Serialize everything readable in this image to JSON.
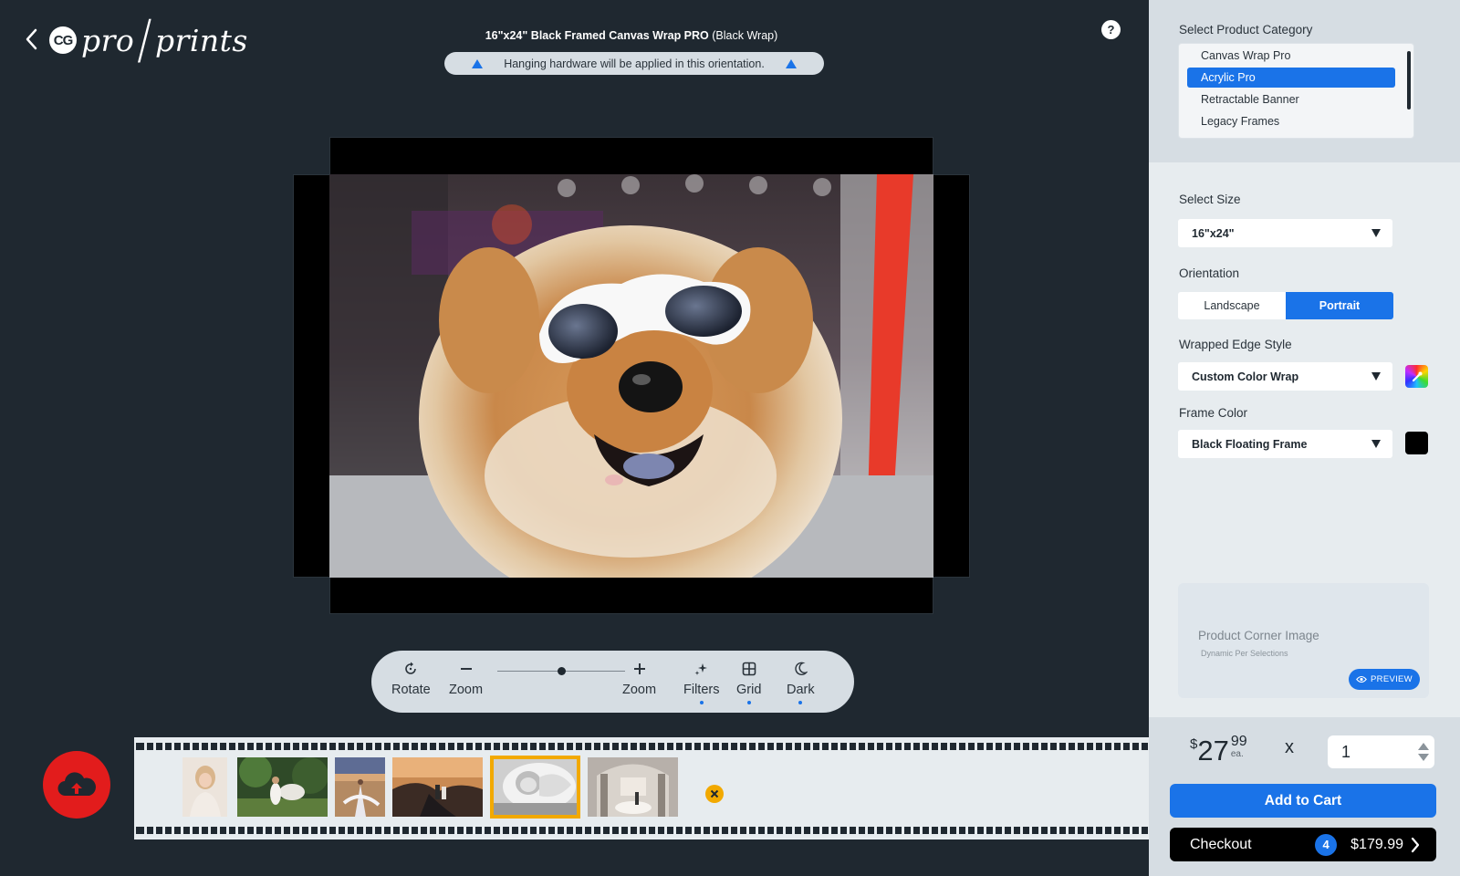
{
  "header": {
    "logo_mark": "CG",
    "logo_word_left": "pro",
    "logo_word_right": "prints",
    "product_title_bold": "16\"x24\" Black Framed Canvas Wrap PRO",
    "product_title_variant": "(Black Wrap)",
    "hanging_notice": "Hanging hardware will be applied in this orientation.",
    "help_label": "?"
  },
  "toolbar": {
    "rotate_label": "Rotate",
    "zoom_out_label": "Zoom",
    "zoom_in_label": "Zoom",
    "filters_label": "Filters",
    "grid_label": "Grid",
    "dark_label": "Dark",
    "zoom_level": 0.5
  },
  "panel": {
    "category": {
      "label": "Select Product Category",
      "items": [
        "Canvas Wrap Pro",
        "Acrylic Pro",
        "Retractable Banner",
        "Legacy Frames"
      ],
      "selected": "Acrylic Pro"
    },
    "size": {
      "label": "Select Size",
      "value": "16\"x24\""
    },
    "orientation": {
      "label": "Orientation",
      "options": [
        "Landscape",
        "Portrait"
      ],
      "selected": "Portrait"
    },
    "edge_style": {
      "label": "Wrapped Edge Style",
      "value": "Custom Color Wrap"
    },
    "frame_color": {
      "label": "Frame Color",
      "value": "Black Floating Frame",
      "swatch": "#000000"
    },
    "corner_image": {
      "title": "Product Corner Image",
      "subtitle": "Dynamic Per Selections",
      "preview_label": "PREVIEW"
    },
    "cart": {
      "currency": "$",
      "price_dollars": "27",
      "price_cents": "99",
      "price_unit": "ea.",
      "times": "x",
      "quantity": "1",
      "add_to_cart_label": "Add to Cart",
      "checkout_label": "Checkout",
      "cart_count": "4",
      "cart_total": "$179.99"
    }
  },
  "colors": {
    "background": "#1f2830",
    "accent": "#1a73e8",
    "upload": "#e21c1c",
    "selection": "#f2a900"
  },
  "filmstrip": {
    "thumbnails": [
      "girl-portrait",
      "girl-forest-horse",
      "dancer-desert",
      "couple-canyon",
      "baby-bw",
      "wedding-hall"
    ],
    "selected_index": 4
  }
}
